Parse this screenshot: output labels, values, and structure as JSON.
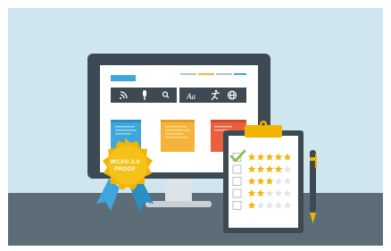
{
  "badge": {
    "line1": "WCAG 2.0",
    "line2": "PROOF"
  },
  "toolbar": {
    "icons": [
      "rss-icon",
      "microphone-icon",
      "search-icon",
      "font-size-icon",
      "accessibility-person-icon",
      "globe-icon"
    ],
    "font_glyph": "Aa"
  },
  "checklist": {
    "rows": [
      {
        "checked": true,
        "stars": 5
      },
      {
        "checked": false,
        "stars": 4
      },
      {
        "checked": false,
        "stars": 3
      },
      {
        "checked": false,
        "stars": 2
      },
      {
        "checked": false,
        "stars": 1
      }
    ]
  },
  "colors": {
    "sky": "#cfe6ee",
    "desk": "#5d6d77",
    "monitor": "#3d4a54",
    "accent_blue": "#3ea6dc",
    "accent_orange": "#f6b33b",
    "accent_red": "#e9603f",
    "badge_gold": "#f2b400",
    "ribbon": "#3ea6dc",
    "check_green": "#7cc243",
    "star": "#f5b50a"
  }
}
